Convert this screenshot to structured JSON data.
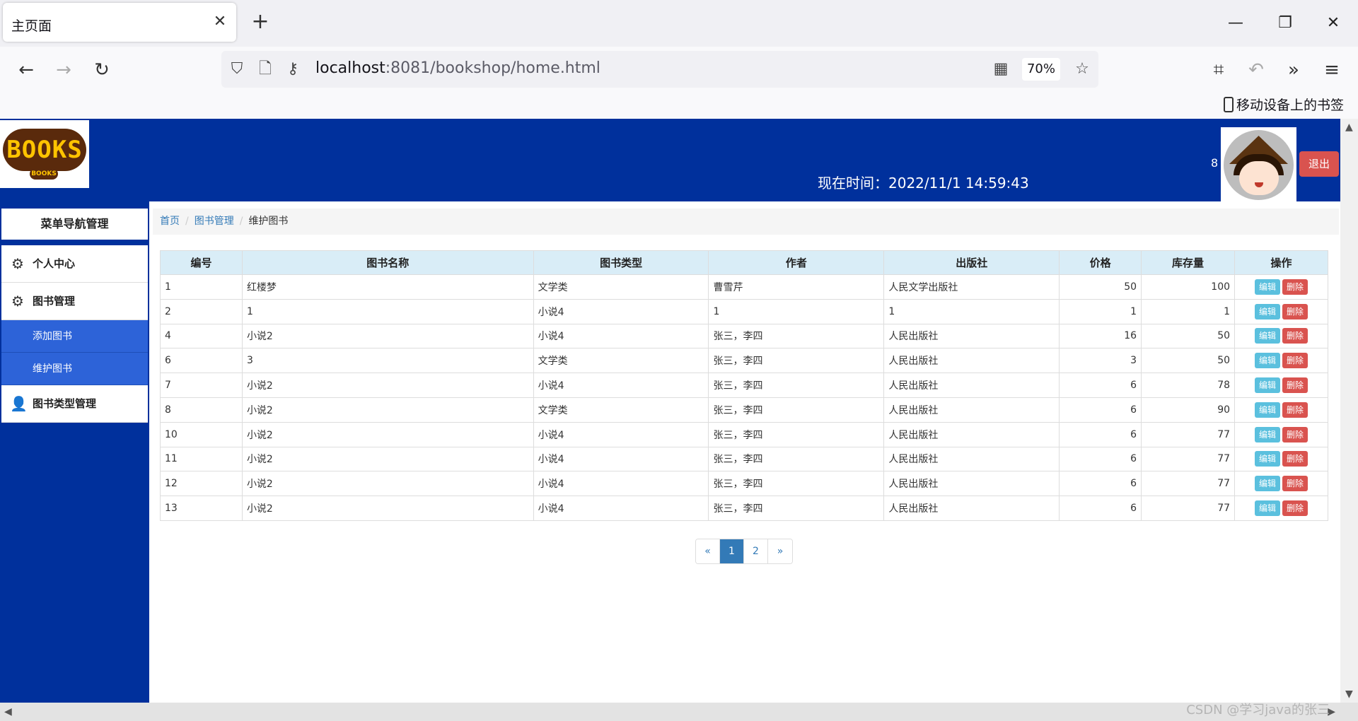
{
  "browser": {
    "tab_title": "主页面",
    "url_host": "localhost",
    "url_rest": ":8081/bookshop/home.html",
    "zoom": "70%",
    "bookmark": "移动设备上的书签",
    "watermark": "CSDN @学习java的张三"
  },
  "header": {
    "logo_text": "BOOKS",
    "logo_sub": "BOOKS",
    "time_label": "现在时间：2022/11/1 14:59:43",
    "user_count": "8",
    "logout": "退出"
  },
  "sidebar": {
    "title": "菜单导航管理",
    "items": [
      {
        "label": "个人中心",
        "icon": "gear-icon"
      },
      {
        "label": "图书管理",
        "icon": "gear-icon"
      },
      {
        "label": "添加图书"
      },
      {
        "label": "维护图书"
      },
      {
        "label": "图书类型管理",
        "icon": "user-icon"
      }
    ]
  },
  "breadcrumb": [
    "首页",
    "图书管理",
    "维护图书"
  ],
  "table": {
    "headers": [
      "编号",
      "图书名称",
      "图书类型",
      "作者",
      "出版社",
      "价格",
      "库存量",
      "操作"
    ],
    "edit_label": "编辑",
    "delete_label": "删除",
    "rows": [
      {
        "id": "1",
        "name": "红楼梦",
        "type": "文学类",
        "author": "曹雪芹",
        "publisher": "人民文学出版社",
        "price": "50",
        "stock": "100"
      },
      {
        "id": "2",
        "name": "1",
        "type": "小说4",
        "author": "1",
        "publisher": "1",
        "price": "1",
        "stock": "1"
      },
      {
        "id": "4",
        "name": "小说2",
        "type": "小说4",
        "author": "张三，李四",
        "publisher": "人民出版社",
        "price": "16",
        "stock": "50"
      },
      {
        "id": "6",
        "name": "3",
        "type": "文学类",
        "author": "张三，李四",
        "publisher": "人民出版社",
        "price": "3",
        "stock": "50"
      },
      {
        "id": "7",
        "name": "小说2",
        "type": "小说4",
        "author": "张三，李四",
        "publisher": "人民出版社",
        "price": "6",
        "stock": "78"
      },
      {
        "id": "8",
        "name": "小说2",
        "type": "文学类",
        "author": "张三，李四",
        "publisher": "人民出版社",
        "price": "6",
        "stock": "90"
      },
      {
        "id": "10",
        "name": "小说2",
        "type": "小说4",
        "author": "张三，李四",
        "publisher": "人民出版社",
        "price": "6",
        "stock": "77"
      },
      {
        "id": "11",
        "name": "小说2",
        "type": "小说4",
        "author": "张三，李四",
        "publisher": "人民出版社",
        "price": "6",
        "stock": "77"
      },
      {
        "id": "12",
        "name": "小说2",
        "type": "小说4",
        "author": "张三，李四",
        "publisher": "人民出版社",
        "price": "6",
        "stock": "77"
      },
      {
        "id": "13",
        "name": "小说2",
        "type": "小说4",
        "author": "张三，李四",
        "publisher": "人民出版社",
        "price": "6",
        "stock": "77"
      }
    ]
  },
  "pagination": {
    "prev": "«",
    "pages": [
      "1",
      "2"
    ],
    "active": "1",
    "next": "»"
  },
  "colors": {
    "header_bg": "#00309c",
    "submenu_bg": "#2d63d8",
    "table_head_bg": "#d9edf7",
    "edit_btn": "#5bc0de",
    "delete_btn": "#d9534f",
    "page_active": "#337ab7"
  }
}
